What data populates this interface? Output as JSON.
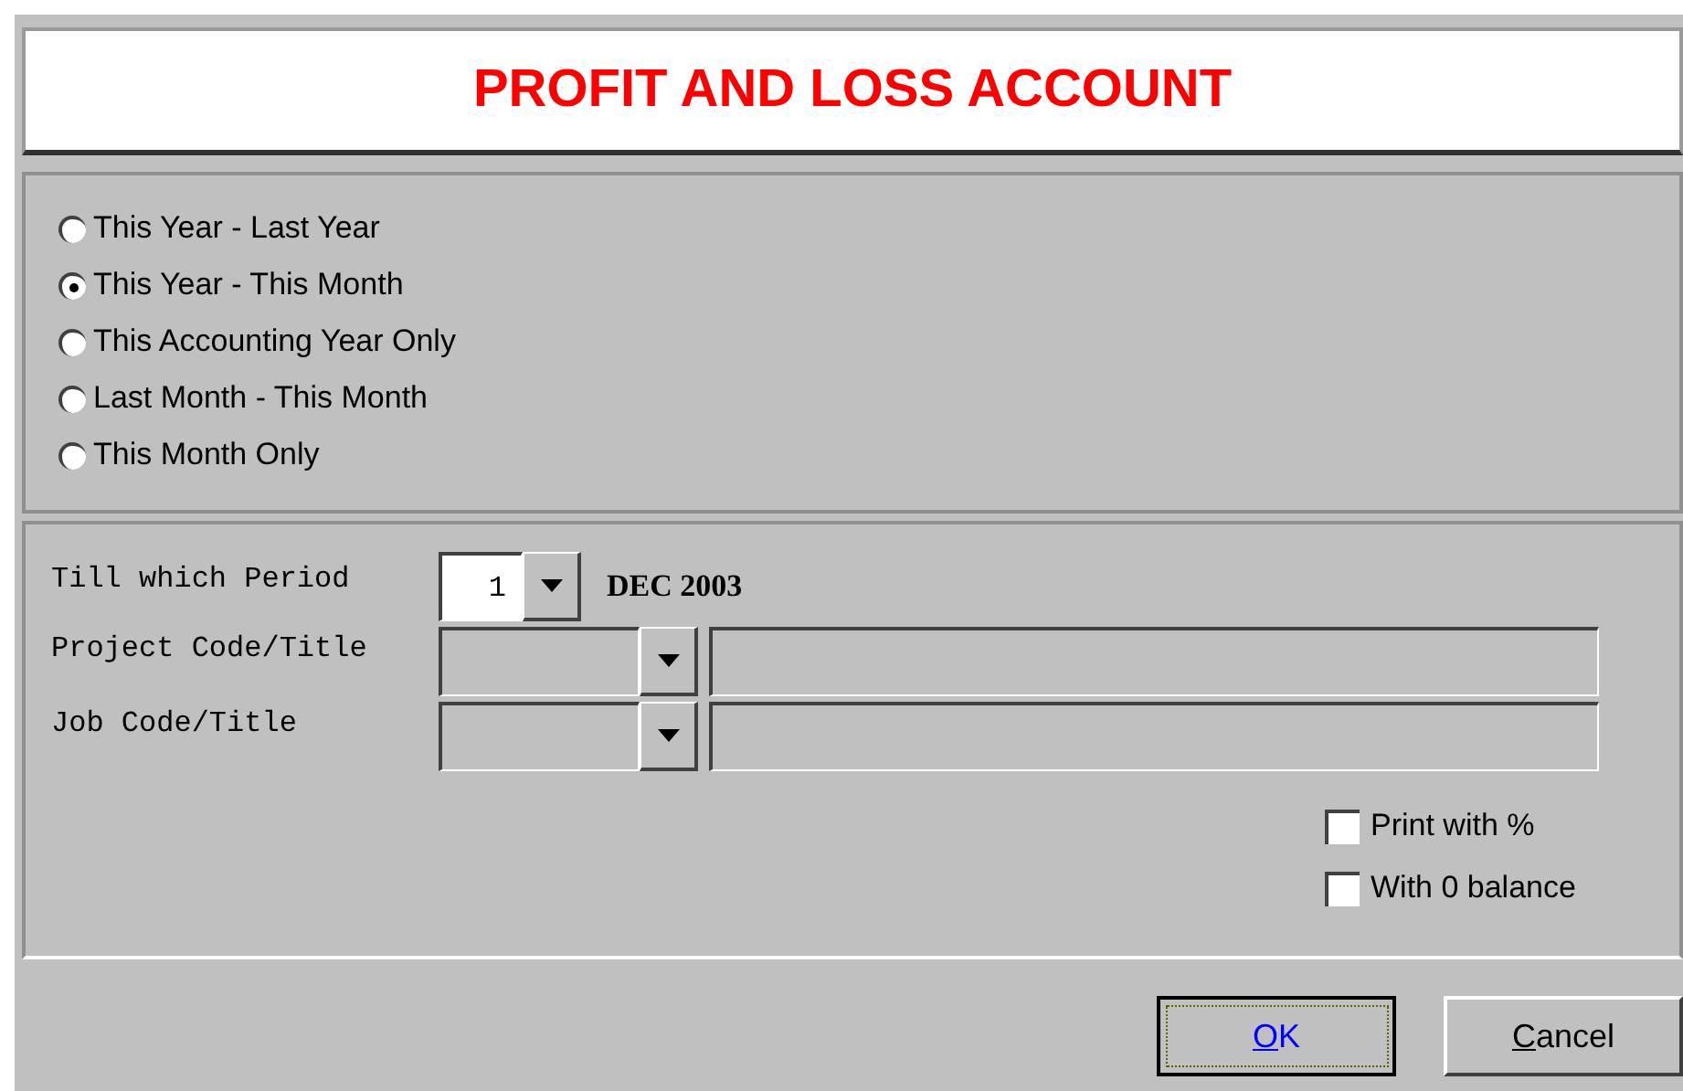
{
  "title": "PROFIT AND LOSS ACCOUNT",
  "periods": [
    {
      "label": "This Year - Last Year",
      "selected": false
    },
    {
      "label": "This Year - This Month",
      "selected": true
    },
    {
      "label": "This Accounting Year Only",
      "selected": false
    },
    {
      "label": "Last Month - This Month",
      "selected": false
    },
    {
      "label": "This Month Only",
      "selected": false
    }
  ],
  "till_period": {
    "label": "Till which Period",
    "value": "1",
    "month": "DEC 2003"
  },
  "lookups": [
    {
      "label": "Project Code/Title"
    },
    {
      "label": "Job Code/Title"
    }
  ],
  "options": [
    {
      "label": "Print with %",
      "checked": false
    },
    {
      "label": "With 0 balance",
      "checked": false
    }
  ],
  "buttons": [
    {
      "accel": "O",
      "rest": "K",
      "focused": true
    },
    {
      "accel": "C",
      "rest": "ancel",
      "focused": false
    }
  ]
}
